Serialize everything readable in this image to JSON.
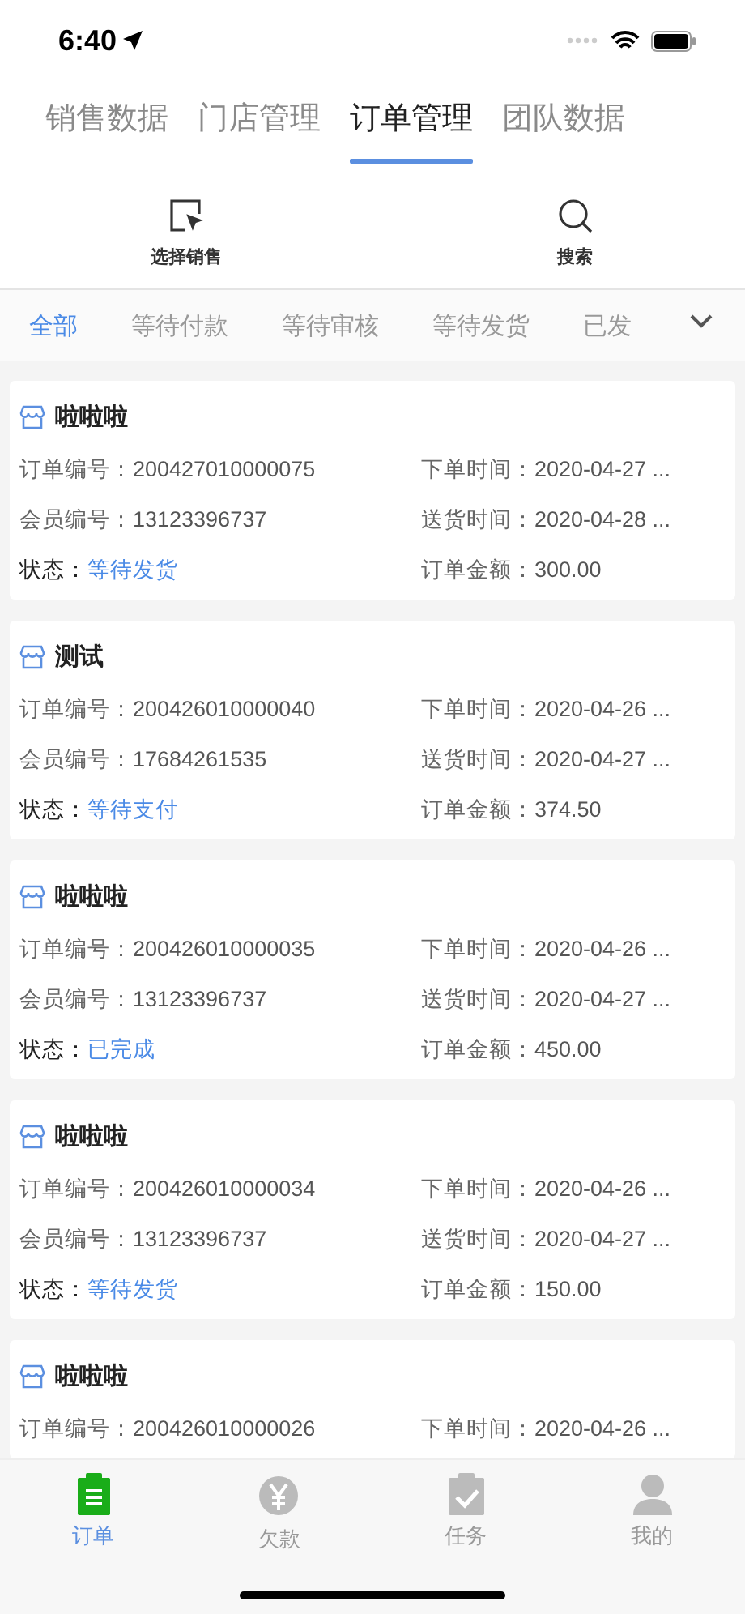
{
  "status_bar": {
    "time": "6:40"
  },
  "top_tabs": [
    {
      "label": "销售数据",
      "selected": false
    },
    {
      "label": "门店管理",
      "selected": false
    },
    {
      "label": "订单管理",
      "selected": true
    },
    {
      "label": "团队数据",
      "selected": false
    }
  ],
  "actions": [
    {
      "kind": "select",
      "label": "选择销售"
    },
    {
      "kind": "search",
      "label": "搜索"
    }
  ],
  "filters": [
    {
      "label": "全部",
      "selected": true
    },
    {
      "label": "等待付款",
      "selected": false
    },
    {
      "label": "等待审核",
      "selected": false
    },
    {
      "label": "等待发货",
      "selected": false
    },
    {
      "label": "已发",
      "selected": false
    }
  ],
  "orders": [
    {
      "store": "啦啦啦",
      "fields": [
        {
          "label": "订单编号：",
          "value": "200427010000075"
        },
        {
          "label": "下单时间：",
          "value": "2020-04-27 ..."
        },
        {
          "label": "会员编号：",
          "value": "13123396737"
        },
        {
          "label": "送货时间：",
          "value": "2020-04-28 ..."
        },
        {
          "kind": "status",
          "label": "状态：",
          "value": "等待发货"
        },
        {
          "label": "订单金额：",
          "value": "300.00"
        }
      ]
    },
    {
      "store": "测试",
      "fields": [
        {
          "label": "订单编号：",
          "value": "200426010000040"
        },
        {
          "label": "下单时间：",
          "value": "2020-04-26 ..."
        },
        {
          "label": "会员编号：",
          "value": "17684261535"
        },
        {
          "label": "送货时间：",
          "value": "2020-04-27 ..."
        },
        {
          "kind": "status",
          "label": "状态：",
          "value": "等待支付"
        },
        {
          "label": "订单金额：",
          "value": "374.50"
        }
      ]
    },
    {
      "store": "啦啦啦",
      "fields": [
        {
          "label": "订单编号：",
          "value": "200426010000035"
        },
        {
          "label": "下单时间：",
          "value": "2020-04-26 ..."
        },
        {
          "label": "会员编号：",
          "value": "13123396737"
        },
        {
          "label": "送货时间：",
          "value": "2020-04-27 ..."
        },
        {
          "kind": "status",
          "label": "状态：",
          "value": "已完成"
        },
        {
          "label": "订单金额：",
          "value": "450.00"
        }
      ]
    },
    {
      "store": "啦啦啦",
      "fields": [
        {
          "label": "订单编号：",
          "value": "200426010000034"
        },
        {
          "label": "下单时间：",
          "value": "2020-04-26 ..."
        },
        {
          "label": "会员编号：",
          "value": "13123396737"
        },
        {
          "label": "送货时间：",
          "value": "2020-04-27 ..."
        },
        {
          "kind": "status",
          "label": "状态：",
          "value": "等待发货"
        },
        {
          "label": "订单金额：",
          "value": "150.00"
        }
      ]
    },
    {
      "store": "啦啦啦",
      "fields": [
        {
          "label": "订单编号：",
          "value": "200426010000026"
        },
        {
          "label": "下单时间：",
          "value": "2020-04-26 ..."
        }
      ]
    }
  ],
  "bottom_tabs": [
    {
      "kind": "orders",
      "label": "订单",
      "selected": true
    },
    {
      "kind": "debt",
      "label": "欠款",
      "selected": false
    },
    {
      "kind": "tasks",
      "label": "任务",
      "selected": false
    },
    {
      "kind": "profile",
      "label": "我的",
      "selected": false
    }
  ]
}
